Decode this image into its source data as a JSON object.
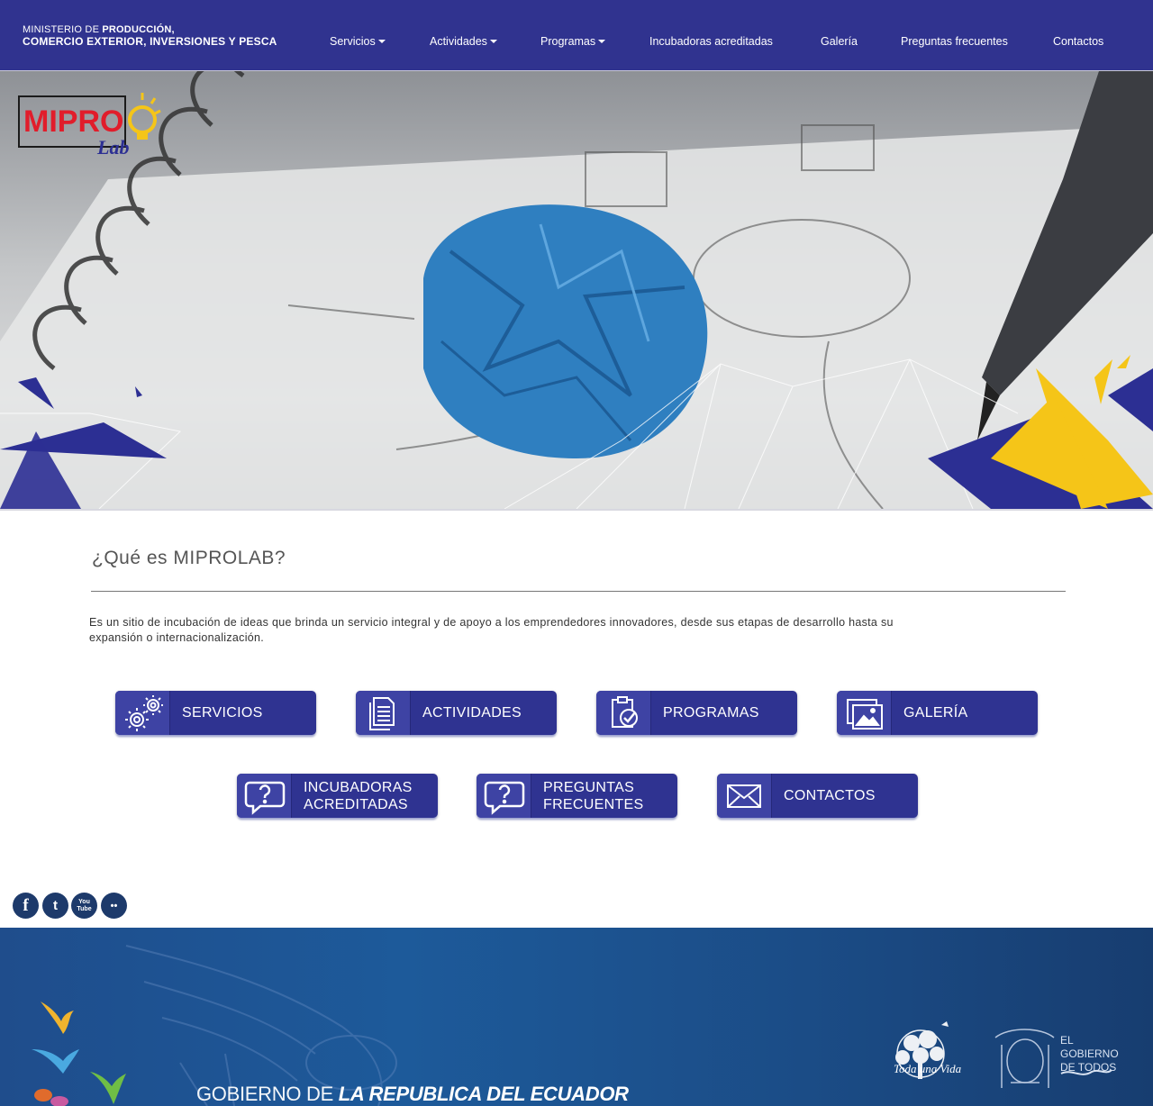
{
  "header": {
    "ministry_line1_prefix": "MINISTERIO DE",
    "ministry_line1_bold": "PRODUCCIÓN,",
    "ministry_line2": "COMERCIO EXTERIOR, INVERSIONES Y PESCA",
    "nav": [
      {
        "label": "Servicios",
        "dropdown": true
      },
      {
        "label": "Actividades",
        "dropdown": true
      },
      {
        "label": "Programas",
        "dropdown": true
      },
      {
        "label": "Incubadoras acreditadas",
        "dropdown": false
      },
      {
        "label": "Galería",
        "dropdown": false
      },
      {
        "label": "Preguntas frecuentes",
        "dropdown": false
      },
      {
        "label": "Contactos",
        "dropdown": false
      }
    ]
  },
  "hero": {
    "logo_text_main": "MIPRO",
    "logo_text_sub": "Lab"
  },
  "content": {
    "title": "¿Qué es MIPROLAB?",
    "intro": "Es un sitio de incubación de ideas que brinda un servicio integral y de apoyo a los emprendedores innovadores, desde sus etapas de desarrollo hasta su expansión o internacionalización.",
    "tiles": [
      {
        "label": "SERVICIOS",
        "icon": "gears-icon"
      },
      {
        "label": "ACTIVIDADES",
        "icon": "documents-icon"
      },
      {
        "label": "PROGRAMAS",
        "icon": "clipboard-check-icon"
      },
      {
        "label": "GALERÍA",
        "icon": "gallery-icon"
      },
      {
        "label_line1": "INCUBADORAS",
        "label_line2": "ACREDITADAS",
        "icon": "question-bubble-icon"
      },
      {
        "label_line1": "PREGUNTAS",
        "label_line2": "FRECUENTES",
        "icon": "question-bubble-icon"
      },
      {
        "label": "CONTACTOS",
        "icon": "envelope-icon"
      }
    ]
  },
  "social": [
    {
      "name": "facebook",
      "glyph": "f"
    },
    {
      "name": "twitter",
      "glyph": "t"
    },
    {
      "name": "youtube",
      "glyph": "You Tube"
    },
    {
      "name": "flickr",
      "glyph": "••"
    }
  ],
  "footer": {
    "gov_thin": "GOBIERNO DE",
    "gov_bold": "LA REPUBLICA DEL ECUADOR",
    "toda_line1": "Toda",
    "toda_line2": "una Vida",
    "gov_todos_1": "EL",
    "gov_todos_2": "GOBIERNO",
    "gov_todos_3": "DE TODOS"
  },
  "colors": {
    "header_bg": "#30338f",
    "tile_bg": "#2f3391",
    "accent_yellow": "#f5c518",
    "footer_bg": "#1d5a9a"
  }
}
